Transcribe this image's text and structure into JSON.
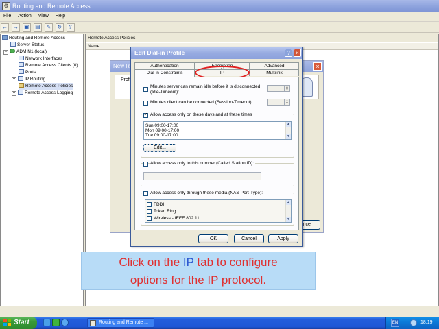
{
  "window": {
    "title": "Routing and Remote Access"
  },
  "menu": [
    "File",
    "Action",
    "View",
    "Help"
  ],
  "toolbar_icons": [
    "back-icon",
    "forward-icon",
    "up-icon",
    "show-tree-icon",
    "properties-icon",
    "refresh-icon",
    "export-icon"
  ],
  "tree": {
    "root": "Routing and Remote Access",
    "items": [
      {
        "label": "Server Status"
      },
      {
        "label": "ADMIN1 (local)"
      },
      {
        "label": "Network Interfaces"
      },
      {
        "label": "Remote Access Clients (0)"
      },
      {
        "label": "Ports"
      },
      {
        "label": "IP Routing"
      },
      {
        "label": "Remote Access Policies"
      },
      {
        "label": "Remote Access Logging"
      }
    ]
  },
  "right_pane": {
    "header": "Remote Access Policies",
    "column_name": "Name"
  },
  "background_dialog": {
    "title": "New Re",
    "content_label": "Profi",
    "cancel_label": "ncel"
  },
  "dialog": {
    "title": "Edit Dial-in Profile",
    "tabs_back": {
      "authentication": "Authentication",
      "encryption": "Encryption",
      "advanced": "Advanced"
    },
    "tabs_front": {
      "dialin_constraints": "Dial-in Constraints",
      "ip": "IP",
      "multilink": "Multilink"
    },
    "idle_timeout_label": "Minutes server can remain idle before it is disconnected (Idle-Timeout):",
    "idle_timeout_line1": "Minutes server can remain idle before it is disconnected",
    "idle_timeout_line2": "(Idle-Timeout):",
    "session_timeout_label": "Minutes client can be connected (Session-Timeout):",
    "allow_days_label": "Allow access only on these days and at these times",
    "allow_days_checked": true,
    "times": [
      "Sun 09:00-17:00",
      "Mon 09:00-17:00",
      "Tue 09:00-17:00"
    ],
    "edit_button": "Edit...",
    "station_label": "Allow access only to this number (Called Station ID):",
    "media_label": "Allow access only through these media (NAS-Port-Type):",
    "media": [
      "FDDI",
      "Token Ring",
      "Wireless - IEEE 802.11"
    ],
    "ok": "OK",
    "cancel": "Cancel",
    "apply": "Apply"
  },
  "callout": {
    "part1": "Click on the ",
    "ip": "IP",
    "part2": " tab to configure",
    "line2": "options for the IP protocol."
  },
  "taskbar": {
    "start": "Start",
    "task_button": "Routing and Remote ...",
    "language": "EN",
    "clock": "18:19"
  },
  "colors": {
    "highlight_ring": "#e02020",
    "callout_text": "#e03030",
    "callout_ip": "#2a56d0",
    "callout_bg": "#b8dcf7"
  }
}
